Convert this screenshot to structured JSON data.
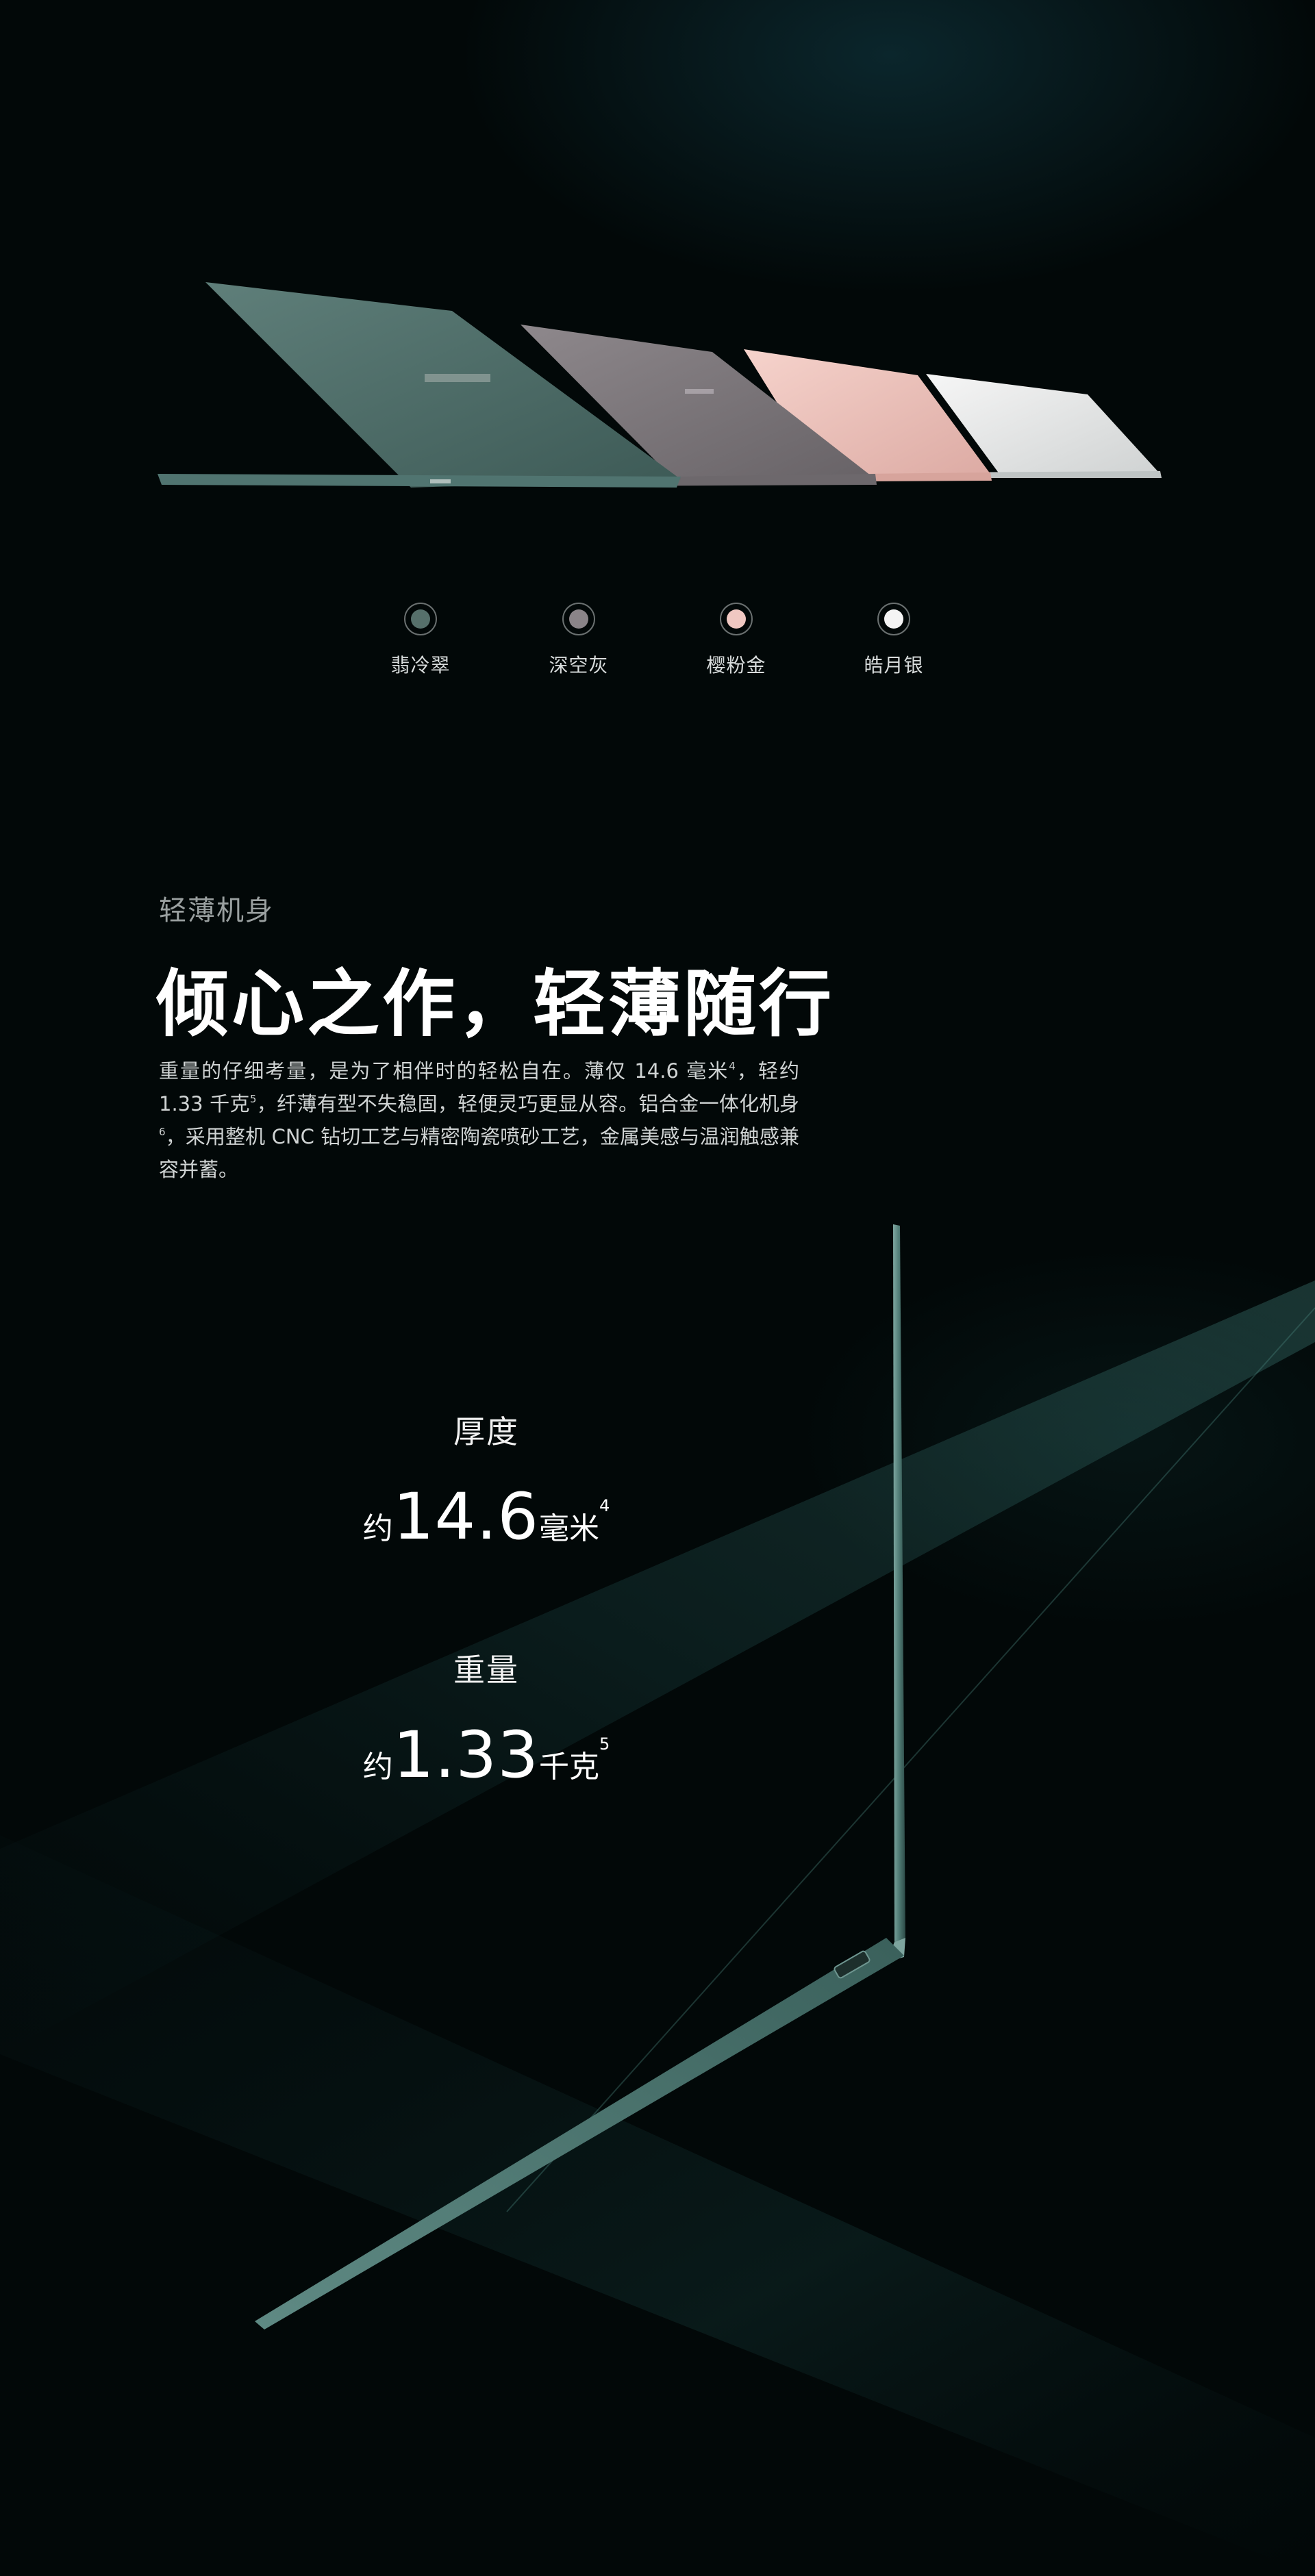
{
  "palette": {
    "background": "#020808",
    "accent_teal": "#3f6e6a"
  },
  "colors_section": {
    "options": [
      {
        "label": "翡冷翠",
        "color": "#56706b"
      },
      {
        "label": "深空灰",
        "color": "#8a8488"
      },
      {
        "label": "樱粉金",
        "color": "#f0c8c2"
      },
      {
        "label": "皓月银",
        "color": "#f4f4f4"
      }
    ]
  },
  "slim_section": {
    "eyebrow": "轻薄机身",
    "headline": "倾心之作，轻薄随行",
    "body_parts": {
      "p1": "重量的仔细考量，是为了相伴时的轻松自在。薄仅 14.6 毫米",
      "s1": "4",
      "p2": "，轻约 1.33 千克",
      "s2": "5",
      "p3": "，纤薄有型不失稳固，轻便灵巧更显从容。铝合金一体化机身",
      "s3": "6",
      "p4": "，采用整机 CNC 钻切工艺与精密陶瓷喷砂工艺，金属美感与温润触感兼容并蓄。"
    },
    "specs": [
      {
        "label": "厚度",
        "prefix": "约",
        "number": "14.6",
        "unit": "毫米",
        "sup": "4"
      },
      {
        "label": "重量",
        "prefix": "约",
        "number": "1.33",
        "unit": "千克",
        "sup": "5"
      }
    ]
  }
}
